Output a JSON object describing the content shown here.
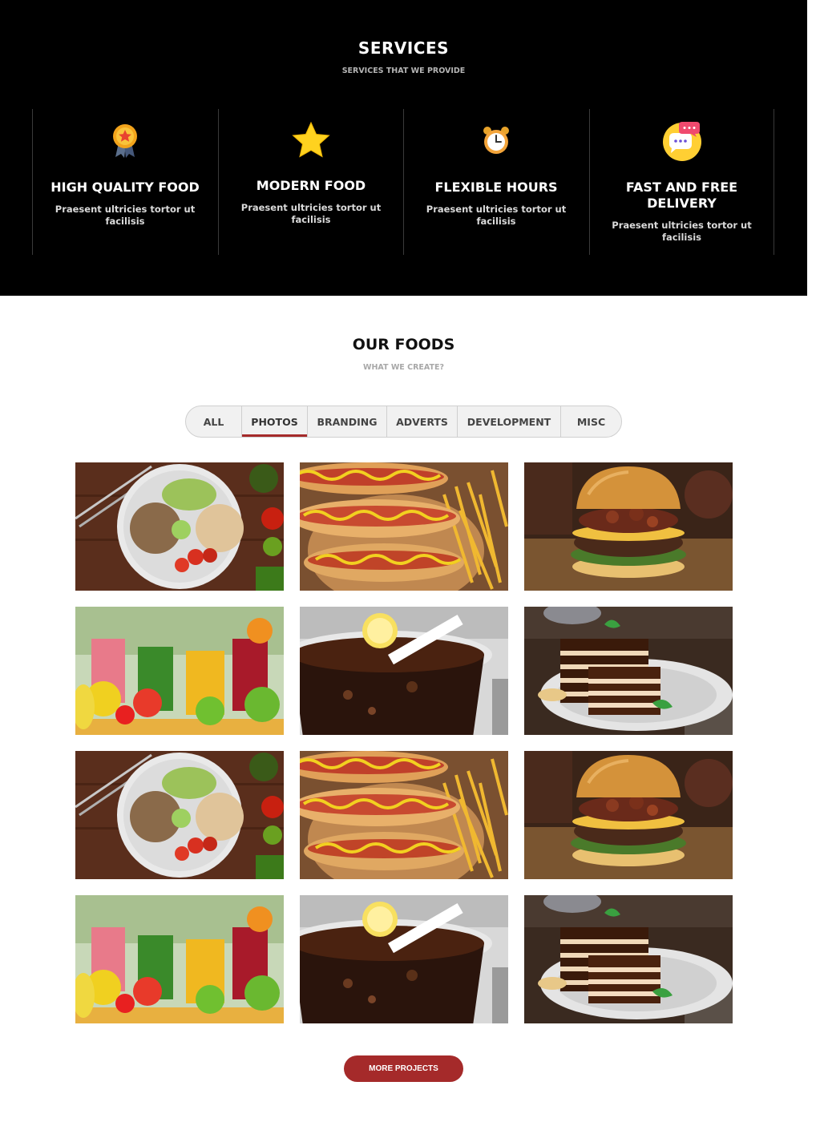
{
  "services": {
    "title": "SERVICES",
    "subtitle": "SERVICES THAT WE PROVIDE",
    "items": [
      {
        "icon": "award-medal-icon",
        "name": "HIGH QUALITY FOOD",
        "desc": "Praesent ultricies tortor ut facilisis"
      },
      {
        "icon": "star-icon",
        "name": "MODERN FOOD",
        "desc": "Praesent ultricies tortor ut facilisis"
      },
      {
        "icon": "alarm-clock-icon",
        "name": "FLEXIBLE HOURS",
        "desc": "Praesent ultricies tortor ut facilisis"
      },
      {
        "icon": "chat-bubbles-icon",
        "name": "FAST AND FREE DELIVERY",
        "desc": "Praesent ultricies tortor ut facilisis"
      }
    ]
  },
  "foods": {
    "title": "OUR FOODS",
    "subtitle": "WHAT WE CREATE?",
    "filters": [
      "ALL",
      "PHOTOS",
      "BRANDING",
      "ADVERTS",
      "DEVELOPMENT",
      "MISC"
    ],
    "active_filter": "PHOTOS",
    "gallery": [
      "salad-bowl",
      "hot-dogs-fries",
      "burger",
      "fruit-smoothies",
      "cola-lemon",
      "layered-cake",
      "salad-bowl",
      "hot-dogs-fries",
      "burger",
      "fruit-smoothies",
      "cola-lemon",
      "layered-cake"
    ],
    "more_button": "MORE PROJECTS"
  },
  "colors": {
    "accent": "#a52a2a",
    "services_bg": "#000000",
    "star": "#ffd21f"
  }
}
